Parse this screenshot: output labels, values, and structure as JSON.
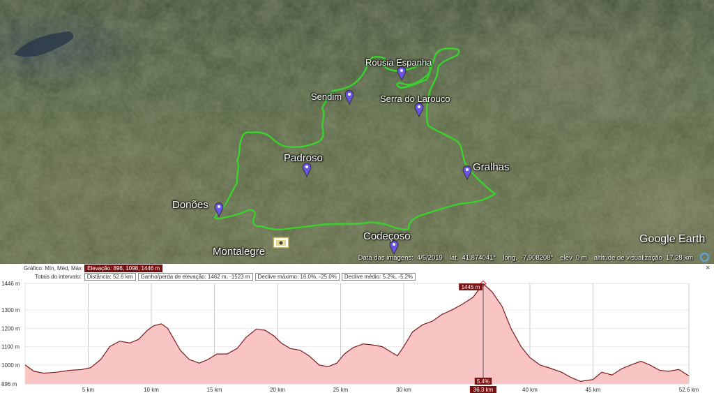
{
  "map": {
    "places": [
      {
        "label": "Rousia Espanha",
        "big": false
      },
      {
        "label": "Sendim",
        "big": false
      },
      {
        "label": "Serra do Larouco",
        "big": false
      },
      {
        "label": "Padroso",
        "big": true
      },
      {
        "label": "Gralhas",
        "big": true
      },
      {
        "label": "Donões",
        "big": true
      },
      {
        "label": "Codeçoso",
        "big": true
      },
      {
        "label": "Montalegre",
        "big": true
      }
    ],
    "logo": "Google Earth",
    "status": {
      "imagery_label": "Data das imagens:",
      "imagery_date": "4/5/2019",
      "lat_label": "lat.",
      "lat": "41.874041°",
      "long_label": "long.",
      "long": "-7.908208°",
      "elev_label": "elev",
      "elev": "0 m",
      "eye_label": "altitude de visualização",
      "eye": "17.28 km"
    },
    "colors": {
      "track": "#3bd22e",
      "pin": "#6a55e0"
    }
  },
  "panel": {
    "row1": {
      "label": "Gráfico: Mín, Méd, Máx",
      "elevation": "Elevação: 896, 1098, 1446 m"
    },
    "row2": {
      "label": "Totais do intervalo:",
      "distance": "Distância: 52.6 km",
      "gain": "Ganho/perda de elevação: 1462 m, -1523 m",
      "max_slope": "Declive máximo: 16.0%, -25.0%",
      "avg_slope": "Declive médio: 5.2%, -5.2%"
    },
    "close_label": "×"
  },
  "chart_data": {
    "type": "area",
    "x_unit": "km",
    "y_unit": "m",
    "xlim": [
      0,
      52.6
    ],
    "ylim": [
      896,
      1446
    ],
    "x_ticks": [
      5,
      10,
      15,
      20,
      25,
      30,
      36.3,
      40,
      45,
      52.6
    ],
    "x_tick_labels": [
      "5 km",
      "10 km",
      "15 km",
      "20 km",
      "25 km",
      "30 km",
      "36.3 km",
      "40 km",
      "45 km",
      "52.6 km"
    ],
    "y_ticks": [
      896,
      1000,
      1100,
      1200,
      1300,
      1446
    ],
    "y_tick_labels": [
      "896 m",
      "1000 m",
      "1100 m",
      "1200 m",
      "1300 m",
      "1446 m"
    ],
    "cursor": {
      "x": 36.3,
      "value_label": "1445 m",
      "slope_label": "5.4%",
      "x_label": "36.3 km"
    },
    "grid": true,
    "x": [
      0,
      0.7,
      1.5,
      2.5,
      3.5,
      4.5,
      5.2,
      6,
      6.7,
      7.5,
      8.3,
      9,
      9.7,
      10.2,
      10.8,
      11.3,
      11.8,
      12.3,
      13,
      13.8,
      14.5,
      15.2,
      16,
      16.8,
      17.5,
      18.3,
      19,
      19.7,
      20.3,
      21,
      21.8,
      22.5,
      23.3,
      24,
      24.7,
      25.3,
      26,
      26.8,
      27.5,
      28.3,
      29,
      29.5,
      30,
      30.7,
      31.5,
      32.3,
      33,
      33.8,
      34.6,
      35.5,
      36.3,
      37,
      37.8,
      38.5,
      39.3,
      40,
      40.8,
      41.7,
      42.5,
      43.3,
      44,
      44.5,
      45,
      45.7,
      46.5,
      47.3,
      48,
      48.8,
      49.5,
      50.3,
      51,
      51.8,
      52.6
    ],
    "series": [
      {
        "values": [
          1000,
          965,
          955,
          960,
          970,
          975,
          985,
          1030,
          1100,
          1130,
          1120,
          1140,
          1190,
          1215,
          1225,
          1200,
          1140,
          1080,
          1030,
          1010,
          1030,
          1060,
          1060,
          1090,
          1150,
          1195,
          1190,
          1160,
          1120,
          1090,
          1080,
          1050,
          1000,
          990,
          1010,
          1060,
          1095,
          1115,
          1110,
          1100,
          1070,
          1050,
          1100,
          1180,
          1220,
          1240,
          1275,
          1300,
          1330,
          1370,
          1445,
          1400,
          1320,
          1200,
          1100,
          1040,
          1000,
          980,
          960,
          930,
          910,
          915,
          920,
          960,
          945,
          980,
          1000,
          1020,
          1000,
          970,
          965,
          975,
          940
        ]
      }
    ]
  }
}
